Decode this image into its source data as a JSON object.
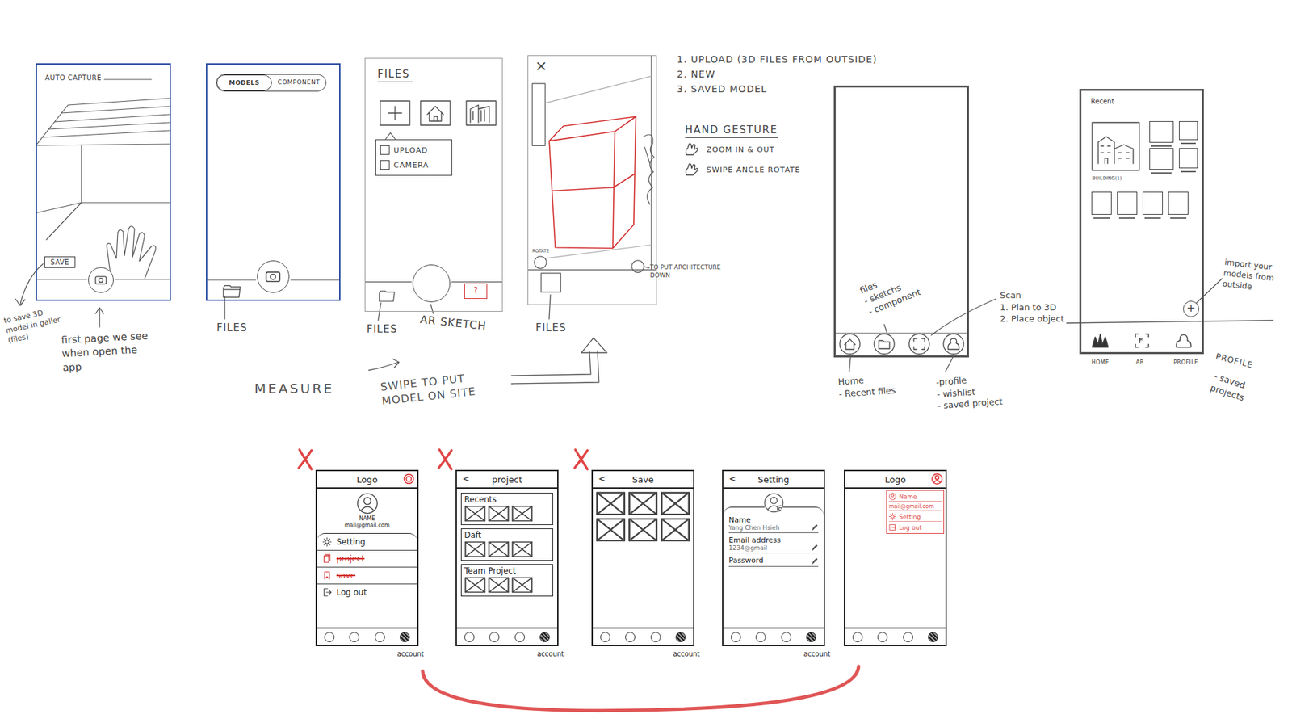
{
  "capture": {
    "label": "AUTO CAPTURE",
    "save": "SAVE",
    "note": "to save 3D model in galler (files)",
    "caption": "first page we see when open the app"
  },
  "library": {
    "tabs": [
      {
        "label": "MODELS",
        "selected": true
      },
      {
        "label": "COMPONENT",
        "selected": false
      }
    ],
    "files_label": "FILES"
  },
  "files_screen": {
    "title": "FILES",
    "menu": [
      "UPLOAD",
      "CAMERA"
    ],
    "help": "?",
    "files_label": "FILES",
    "sketch_label": "AR SKETCH"
  },
  "flow": {
    "measure": "MEASURE",
    "swipe": "SWIPE TO PUT MODEL ON SITE"
  },
  "ar_screen": {
    "close": "×",
    "rotate": "ROTATE",
    "put_down": "TO PUT ARCHITECTURE DOWN",
    "files_label": "FILES"
  },
  "notes": {
    "options": [
      "1. UPLOAD (3D FILES FROM OUTSIDE)",
      "2. NEW",
      "3. SAVED MODEL"
    ],
    "gesture_title": "HAND GESTURE",
    "gestures": [
      "ZOOM IN & OUT",
      "SWIPE ANGLE ROTATE"
    ]
  },
  "nav_sketch": {
    "files": [
      "files",
      "- sketchs",
      "- component"
    ],
    "home": [
      "Home",
      "- Recent files"
    ],
    "scan": [
      "Scan",
      "1. Plan to 3D",
      "2. Place object"
    ],
    "profile": [
      "-profile",
      "- wishlist",
      "- saved project"
    ]
  },
  "recent": {
    "title": "Recent",
    "item": "BUILDING(1)",
    "add": "+",
    "import": "import your models from outside",
    "nav": [
      "HOME",
      "AR",
      "PROFILE"
    ],
    "profile_note": [
      "PROFILE",
      "- saved projects"
    ]
  },
  "wireframes": [
    {
      "kind": "menu",
      "rejected": true,
      "back": "",
      "header": "Logo",
      "name": "NAME",
      "email": "mail@gmail.com",
      "items": [
        {
          "label": "Setting",
          "kind": "gear",
          "struck": false
        },
        {
          "label": "project",
          "kind": "file",
          "struck": true
        },
        {
          "label": "save",
          "kind": "bookmark",
          "struck": true
        },
        {
          "label": "Log out",
          "kind": "logout",
          "struck": false
        }
      ],
      "nav": [
        {
          "selected": false
        },
        {
          "selected": false
        },
        {
          "selected": false
        },
        {
          "selected": true
        }
      ],
      "footer": "account"
    },
    {
      "kind": "project",
      "rejected": true,
      "back": "<",
      "header": "project",
      "sections": [
        {
          "title": "Recents",
          "thumbs": 3
        },
        {
          "title": "Daft",
          "thumbs": 3
        },
        {
          "title": "Team Project",
          "thumbs": 3
        }
      ],
      "nav": [
        {
          "selected": false
        },
        {
          "selected": false
        },
        {
          "selected": false
        },
        {
          "selected": true
        }
      ],
      "footer": "account"
    },
    {
      "kind": "save",
      "rejected": true,
      "back": "<",
      "header": "Save",
      "thumbs": 6,
      "nav": [
        {
          "selected": false
        },
        {
          "selected": false
        },
        {
          "selected": false
        },
        {
          "selected": true
        }
      ],
      "footer": "account"
    },
    {
      "kind": "setting",
      "rejected": false,
      "back": "<",
      "header": "Setting",
      "fields": [
        {
          "label": "Name",
          "value": "Yang Chen Hsieh"
        },
        {
          "label": "Email address",
          "value": "1234@gmail"
        },
        {
          "label": "Password",
          "value": ""
        }
      ],
      "nav": [
        {
          "selected": false
        },
        {
          "selected": false
        },
        {
          "selected": false
        },
        {
          "selected": true
        }
      ],
      "footer": "account"
    },
    {
      "kind": "dropdown",
      "rejected": false,
      "back": "",
      "header": "Logo",
      "menu": [
        {
          "label": "Name",
          "kind": "user"
        },
        {
          "label": "mail@gmail.com",
          "kind": "text"
        },
        {
          "label": "Setting",
          "kind": "gear"
        },
        {
          "label": "Log out",
          "kind": "logout"
        }
      ],
      "nav": [
        {
          "selected": false
        },
        {
          "selected": false
        },
        {
          "selected": false
        },
        {
          "selected": true
        }
      ],
      "footer": ""
    }
  ]
}
